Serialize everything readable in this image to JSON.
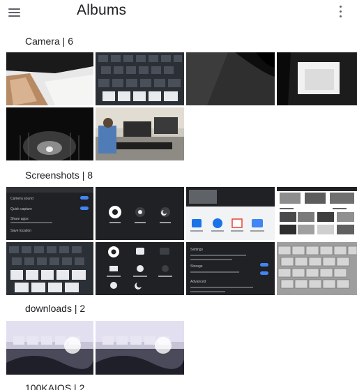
{
  "app": {
    "title": "Albums",
    "menu_icon": "hamburger-menu-icon",
    "more_icon": "more-vertical-icon"
  },
  "albums": [
    {
      "name": "Camera",
      "count": 6,
      "header": "Camera | 6"
    },
    {
      "name": "Screenshots",
      "count": 8,
      "header": "Screenshots | 8"
    },
    {
      "name": "downloads",
      "count": 2,
      "header": "downloads | 2"
    },
    {
      "name": "100KAIOS",
      "count": 2,
      "header": "100KAIOS | 2"
    }
  ],
  "screenshot_text": {
    "camera_sound": "Camera sound",
    "quick_capture": "Quick capture",
    "share_apps": "Share apps",
    "save_location": "Save location",
    "storage": "Storage",
    "advanced": "Advanced",
    "settings": "Settings"
  },
  "colors": {
    "text_primary": "#202124",
    "icon_gray": "#5f6368",
    "accent_blue": "#4285f4",
    "background": "#ffffff"
  }
}
